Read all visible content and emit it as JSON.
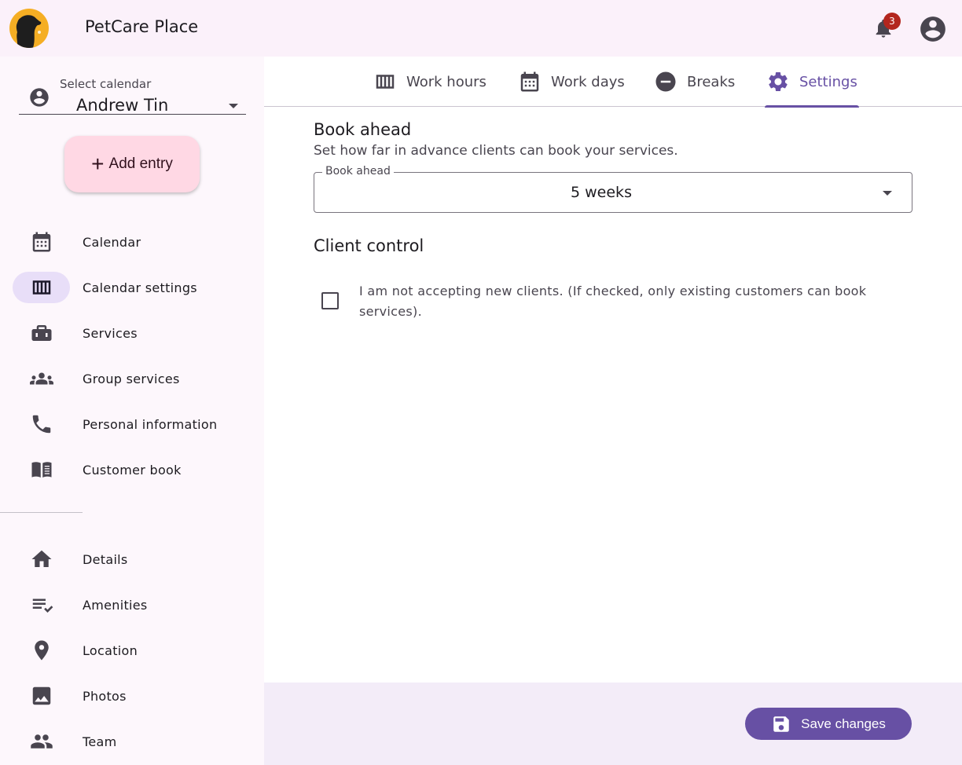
{
  "header": {
    "app_title": "PetCare Place",
    "notification_count": "3",
    "logo_icon": "dog-logo",
    "notifications_icon": "bell-icon",
    "account_icon": "account-circle-icon"
  },
  "sidebar": {
    "calendar_select": {
      "label": "Select calendar",
      "value": "Andrew Tin"
    },
    "add_entry_label": "Add entry",
    "items": [
      {
        "label": "Calendar",
        "icon": "calendar-icon",
        "active": false
      },
      {
        "label": "Calendar settings",
        "icon": "view-week-icon",
        "active": true
      },
      {
        "label": "Services",
        "icon": "toolbox-icon",
        "active": false
      },
      {
        "label": "Group services",
        "icon": "groups-icon",
        "active": false
      },
      {
        "label": "Personal information",
        "icon": "phone-icon",
        "active": false
      },
      {
        "label": "Customer book",
        "icon": "book-icon",
        "active": false
      }
    ],
    "business_items": [
      {
        "label": "Details",
        "icon": "home-icon"
      },
      {
        "label": "Amenities",
        "icon": "checklist-icon"
      },
      {
        "label": "Location",
        "icon": "location-pin-icon"
      },
      {
        "label": "Photos",
        "icon": "image-icon"
      },
      {
        "label": "Team",
        "icon": "people-icon"
      }
    ]
  },
  "tabs": [
    {
      "label": "Work hours",
      "icon": "view-week-icon",
      "active": false
    },
    {
      "label": "Work days",
      "icon": "calendar-icon",
      "active": false
    },
    {
      "label": "Breaks",
      "icon": "minus-circle-icon",
      "active": false
    },
    {
      "label": "Settings",
      "icon": "gear-icon",
      "active": true
    }
  ],
  "settings": {
    "book_ahead": {
      "title": "Book ahead",
      "description": "Set how far in advance clients can book your services.",
      "field_label": "Book ahead",
      "value": "5 weeks"
    },
    "client_control": {
      "title": "Client control",
      "checkbox_label": "I am not accepting new clients. (If checked, only existing customers can book services).",
      "checked": false
    }
  },
  "footer": {
    "save_label": "Save changes"
  },
  "colors": {
    "primary": "#6750a4",
    "add_entry_bg": "#ffd8e4",
    "active_nav_bg": "#e8def8",
    "badge": "#b3261e",
    "logo": "#f5ae24"
  }
}
